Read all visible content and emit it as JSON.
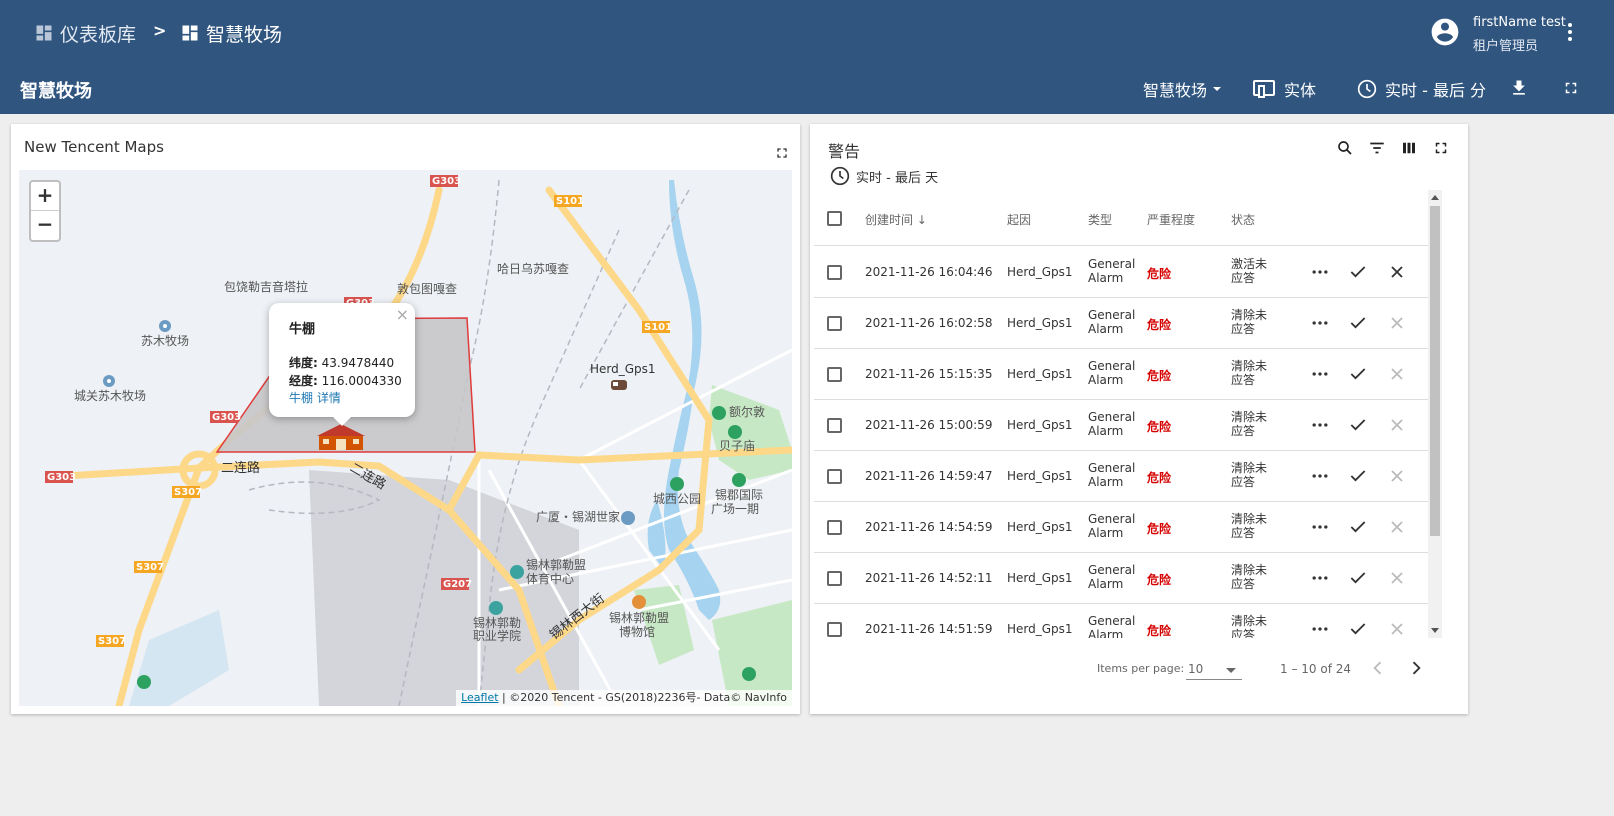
{
  "breadcrumb": {
    "root_label": "仪表板库",
    "separator": ">",
    "current_label": "智慧牧场"
  },
  "user": {
    "name": "firstName test",
    "role": "租户管理员"
  },
  "toolbar": {
    "dashboard_title": "智慧牧场",
    "state_select_label": "智慧牧场",
    "entities_label": "实体",
    "timewindow_label": "实时 - 最后 分"
  },
  "map_widget": {
    "title": "New Tencent Maps",
    "zoom_in": "+",
    "zoom_out": "−",
    "place_labels": {
      "baorao": "包饶勒吉音塔拉",
      "dunbao": "敦包图嘎查",
      "harwu": "哈日乌苏嘎查",
      "sumu": "苏木牧场",
      "chengguan": "城关苏木牧场",
      "herd": "Herd_Gps1",
      "erlian1": "二连路",
      "erlian2": "二连路",
      "eerdun": "额尔敦",
      "beizi": "贝子庙",
      "chengxi": "城西公园",
      "xilin_plaza": "锡郡国际",
      "xilin_plaza2": "广场一期",
      "guangsha": "广厦・锡湖世家",
      "sports1": "锡林郭勒盟",
      "sports2": "体育中心",
      "college1": "锡林郭勒",
      "college2": "职业学院",
      "museum1": "锡林郭勒盟",
      "museum2": "博物馆",
      "xilinxi": "锡林西大街"
    },
    "road_shields": {
      "g303_a": "G303",
      "g303_b": "G303",
      "g303_c": "G303",
      "s101_a": "S101",
      "s101_b": "S101",
      "s307_a": "S307",
      "s307_b": "S307",
      "s307_c": "S307",
      "g207": "G207",
      "g303_d": "G303"
    },
    "popup": {
      "close": "×",
      "title": "牛棚",
      "lat_label": "纬度:",
      "lat_value": "43.9478440",
      "lon_label": "经度:",
      "lon_value": "116.0004330",
      "link": "牛棚 详情"
    },
    "attribution": {
      "leaflet": "Leaflet",
      "rest": " | ©2020 Tencent - GS(2018)2236号- Data© NavInfo"
    }
  },
  "alarm_widget": {
    "title": "警告",
    "timewindow": "实时 - 最后 天",
    "columns": {
      "created_time": "创建时间",
      "originator": "起因",
      "type": "类型",
      "severity": "严重程度",
      "status": "状态"
    },
    "rows": [
      {
        "time": "2021-11-26 16:04:46",
        "originator": "Herd_Gps1",
        "type_1": "General",
        "type_2": "Alarm",
        "severity": "危险",
        "status_1": "激活未",
        "status_2": "应答"
      },
      {
        "time": "2021-11-26 16:02:58",
        "originator": "Herd_Gps1",
        "type_1": "General",
        "type_2": "Alarm",
        "severity": "危险",
        "status_1": "清除未",
        "status_2": "应答"
      },
      {
        "time": "2021-11-26 15:15:35",
        "originator": "Herd_Gps1",
        "type_1": "General",
        "type_2": "Alarm",
        "severity": "危险",
        "status_1": "清除未",
        "status_2": "应答"
      },
      {
        "time": "2021-11-26 15:00:59",
        "originator": "Herd_Gps1",
        "type_1": "General",
        "type_2": "Alarm",
        "severity": "危险",
        "status_1": "清除未",
        "status_2": "应答"
      },
      {
        "time": "2021-11-26 14:59:47",
        "originator": "Herd_Gps1",
        "type_1": "General",
        "type_2": "Alarm",
        "severity": "危险",
        "status_1": "清除未",
        "status_2": "应答"
      },
      {
        "time": "2021-11-26 14:54:59",
        "originator": "Herd_Gps1",
        "type_1": "General",
        "type_2": "Alarm",
        "severity": "危险",
        "status_1": "清除未",
        "status_2": "应答"
      },
      {
        "time": "2021-11-26 14:52:11",
        "originator": "Herd_Gps1",
        "type_1": "General",
        "type_2": "Alarm",
        "severity": "危险",
        "status_1": "清除未",
        "status_2": "应答"
      },
      {
        "time": "2021-11-26 14:51:59",
        "originator": "Herd_Gps1",
        "type_1": "General",
        "type_2": "Alarm",
        "severity": "危险",
        "status_1": "清除未",
        "status_2": "应答"
      }
    ],
    "pager": {
      "items_per_page_label": "Items per page:",
      "items_per_page_value": "10",
      "range": "1 – 10 of 24"
    }
  },
  "colors": {
    "header_bg": "#305680",
    "severity_critical": "#d50000",
    "map_bg": "#eef1f5",
    "road": "#fcd888",
    "water": "#a5d3f0",
    "park": "#c7e8c4"
  },
  "icons": {
    "dashboards": "dashboard-icon",
    "account": "account-circle-icon",
    "more": "more-vert-icon",
    "entities": "devices-icon",
    "timewindow": "clock-icon",
    "download": "download-icon",
    "fullscreen": "fullscreen-icon",
    "search": "search-icon",
    "filter": "filter-icon",
    "columns": "view-column-icon",
    "ack": "check-icon",
    "clear": "close-icon",
    "details": "more-horiz-icon"
  }
}
